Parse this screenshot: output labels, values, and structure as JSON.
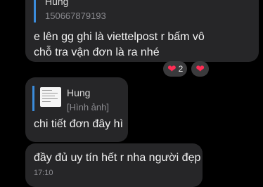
{
  "messages": [
    {
      "quote_name": "Hung",
      "quote_text": "150667879193",
      "text_line1": "e lên gg ghi là viettelpost r bấm vô",
      "text_line2": "chỗ tra vận đơn là ra nhé",
      "reactions": [
        {
          "emoji": "❤",
          "count": "2"
        },
        {
          "emoji": "❤",
          "count": ""
        }
      ]
    },
    {
      "quote_name": "Hung",
      "quote_text": "[Hình ảnh]",
      "text": "chi tiết đơn đây hì"
    },
    {
      "text": "đầy đủ uy tín hết r nha người đẹp",
      "time": "17:10"
    }
  ],
  "colors": {
    "background": "#000000",
    "bubble": "#262628",
    "quote_bar": "#3b8cdb",
    "heart": "#ff2d55"
  }
}
